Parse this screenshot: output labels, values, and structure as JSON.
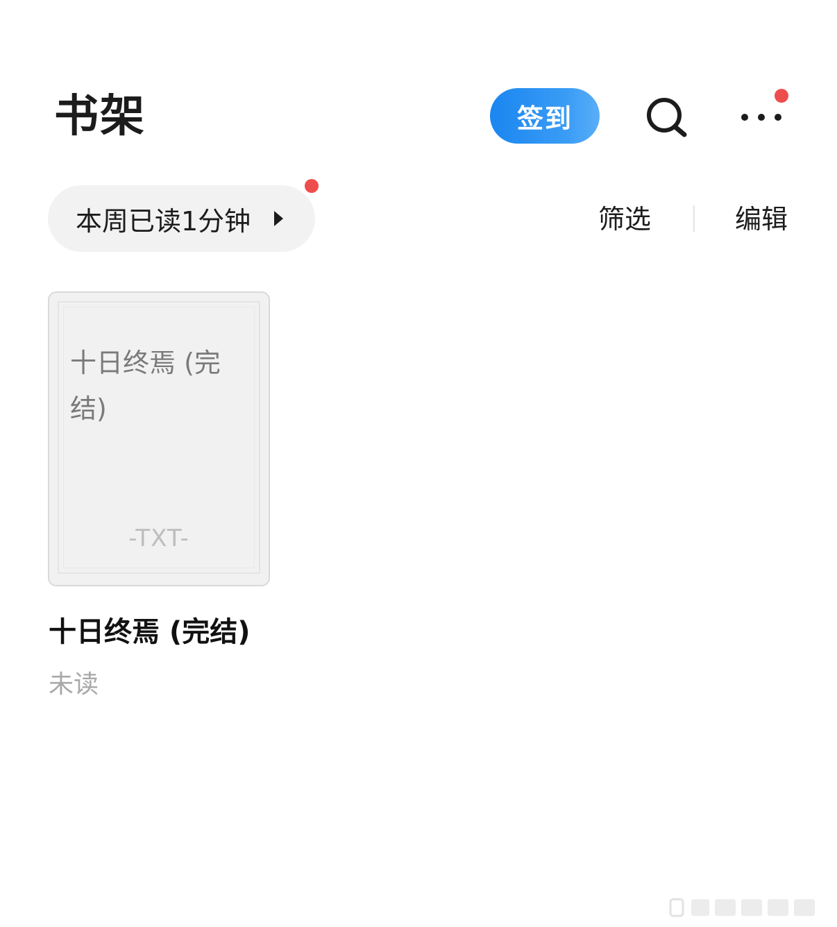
{
  "header": {
    "title": "书架",
    "checkin_label": "签到",
    "search_icon": "search-icon",
    "more_icon": "more-icon",
    "more_has_badge": true
  },
  "toolbar": {
    "reading_time_label": "本周已读1分钟",
    "reading_has_badge": true,
    "filter_label": "筛选",
    "edit_label": "编辑"
  },
  "books": [
    {
      "cover_title": "十日终焉 (完结)",
      "cover_format": "-TXT-",
      "title": "十日终焉 (完结)",
      "status": "未读"
    }
  ],
  "colors": {
    "accent": "#1a86f0",
    "badge": "#ee4d4d",
    "pill_background": "#f2f2f2",
    "muted_text": "#a8a8a8"
  }
}
